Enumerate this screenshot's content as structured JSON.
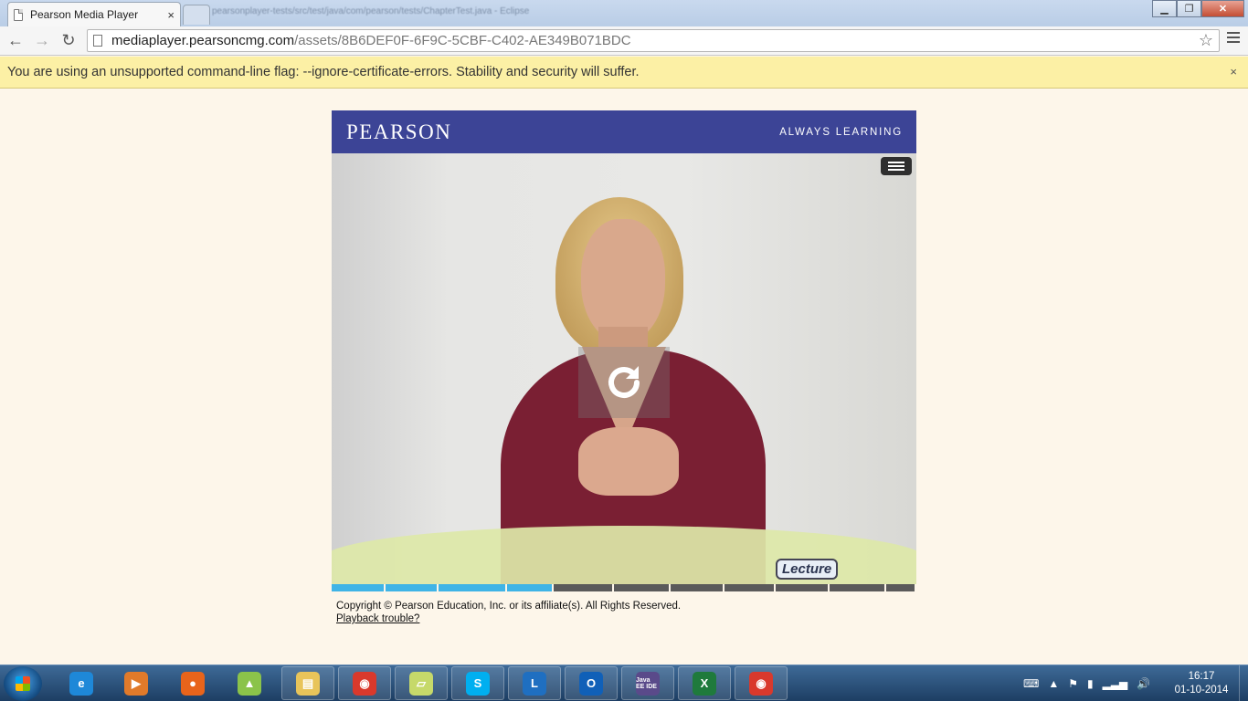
{
  "browser": {
    "tab_title": "Pearson Media Player",
    "tab_close": "×",
    "url_host": "mediaplayer.pearsoncmg.com",
    "url_path": "/assets/8B6DEF0F-6F9C-5CBF-C402-AE349B071BDC",
    "background_title": "pearsonplayer-tests/src/test/java/com/pearson/tests/ChapterTest.java - Eclipse",
    "back_icon": "←",
    "forward_icon": "→",
    "reload_icon": "↻",
    "star_icon": "☆"
  },
  "window_controls": {
    "minimize": "▁",
    "maximize": "❐",
    "close": "✕"
  },
  "infobar": {
    "message": "You are using an unsupported command-line flag: --ignore-certificate-errors. Stability and security will suffer.",
    "close": "×"
  },
  "player": {
    "brand": "PEARSON",
    "tagline": "ALWAYS LEARNING",
    "watermark": "Lecture",
    "copyright": "Copyright © Pearson Education, Inc. or its affiliate(s). All Rights Reserved.",
    "playback_link": "Playback trouble?",
    "chapters": [
      {
        "watched": true,
        "color": "#3fb4e6"
      },
      {
        "watched": true,
        "color": "#3fb4e6"
      },
      {
        "watched": true,
        "color": "#3fb4e6"
      },
      {
        "watched": true,
        "color": "#3fb4e6"
      },
      {
        "watched": false,
        "color": "#5a5a5a"
      },
      {
        "watched": false,
        "color": "#5a5a5a"
      },
      {
        "watched": false,
        "color": "#5a5a5a"
      },
      {
        "watched": false,
        "color": "#5a5a5a"
      },
      {
        "watched": false,
        "color": "#5a5a5a"
      },
      {
        "watched": false,
        "color": "#5a5a5a"
      },
      {
        "watched": false,
        "color": "#5a5a5a"
      }
    ]
  },
  "taskbar": {
    "apps": [
      {
        "name": "internet-explorer-icon",
        "glyph": "e",
        "color": "#1e88d8"
      },
      {
        "name": "media-player-icon",
        "glyph": "▶",
        "color": "#e07a2a"
      },
      {
        "name": "firefox-icon",
        "glyph": "●",
        "color": "#e8641b"
      },
      {
        "name": "android-icon",
        "glyph": "▲",
        "color": "#8bc34a"
      },
      {
        "name": "file-explorer-icon",
        "glyph": "▤",
        "color": "#e8c45a"
      },
      {
        "name": "chrome-icon",
        "glyph": "◉",
        "color": "#d9392c"
      },
      {
        "name": "sticky-notes-icon",
        "glyph": "▱",
        "color": "#c6d96a"
      },
      {
        "name": "skype-icon",
        "glyph": "S",
        "color": "#00aff0"
      },
      {
        "name": "lync-icon",
        "glyph": "L",
        "color": "#1f6fc1"
      },
      {
        "name": "outlook-icon",
        "glyph": "O",
        "color": "#1060b8"
      },
      {
        "name": "java-ee-ide-icon",
        "glyph": "Java EE IDE",
        "color": "#5a4a8a"
      },
      {
        "name": "excel-icon",
        "glyph": "X",
        "color": "#1f7a3c"
      },
      {
        "name": "chrome-active-icon",
        "glyph": "◉",
        "color": "#d9392c"
      }
    ],
    "time": "16:17",
    "date": "01-10-2014"
  }
}
